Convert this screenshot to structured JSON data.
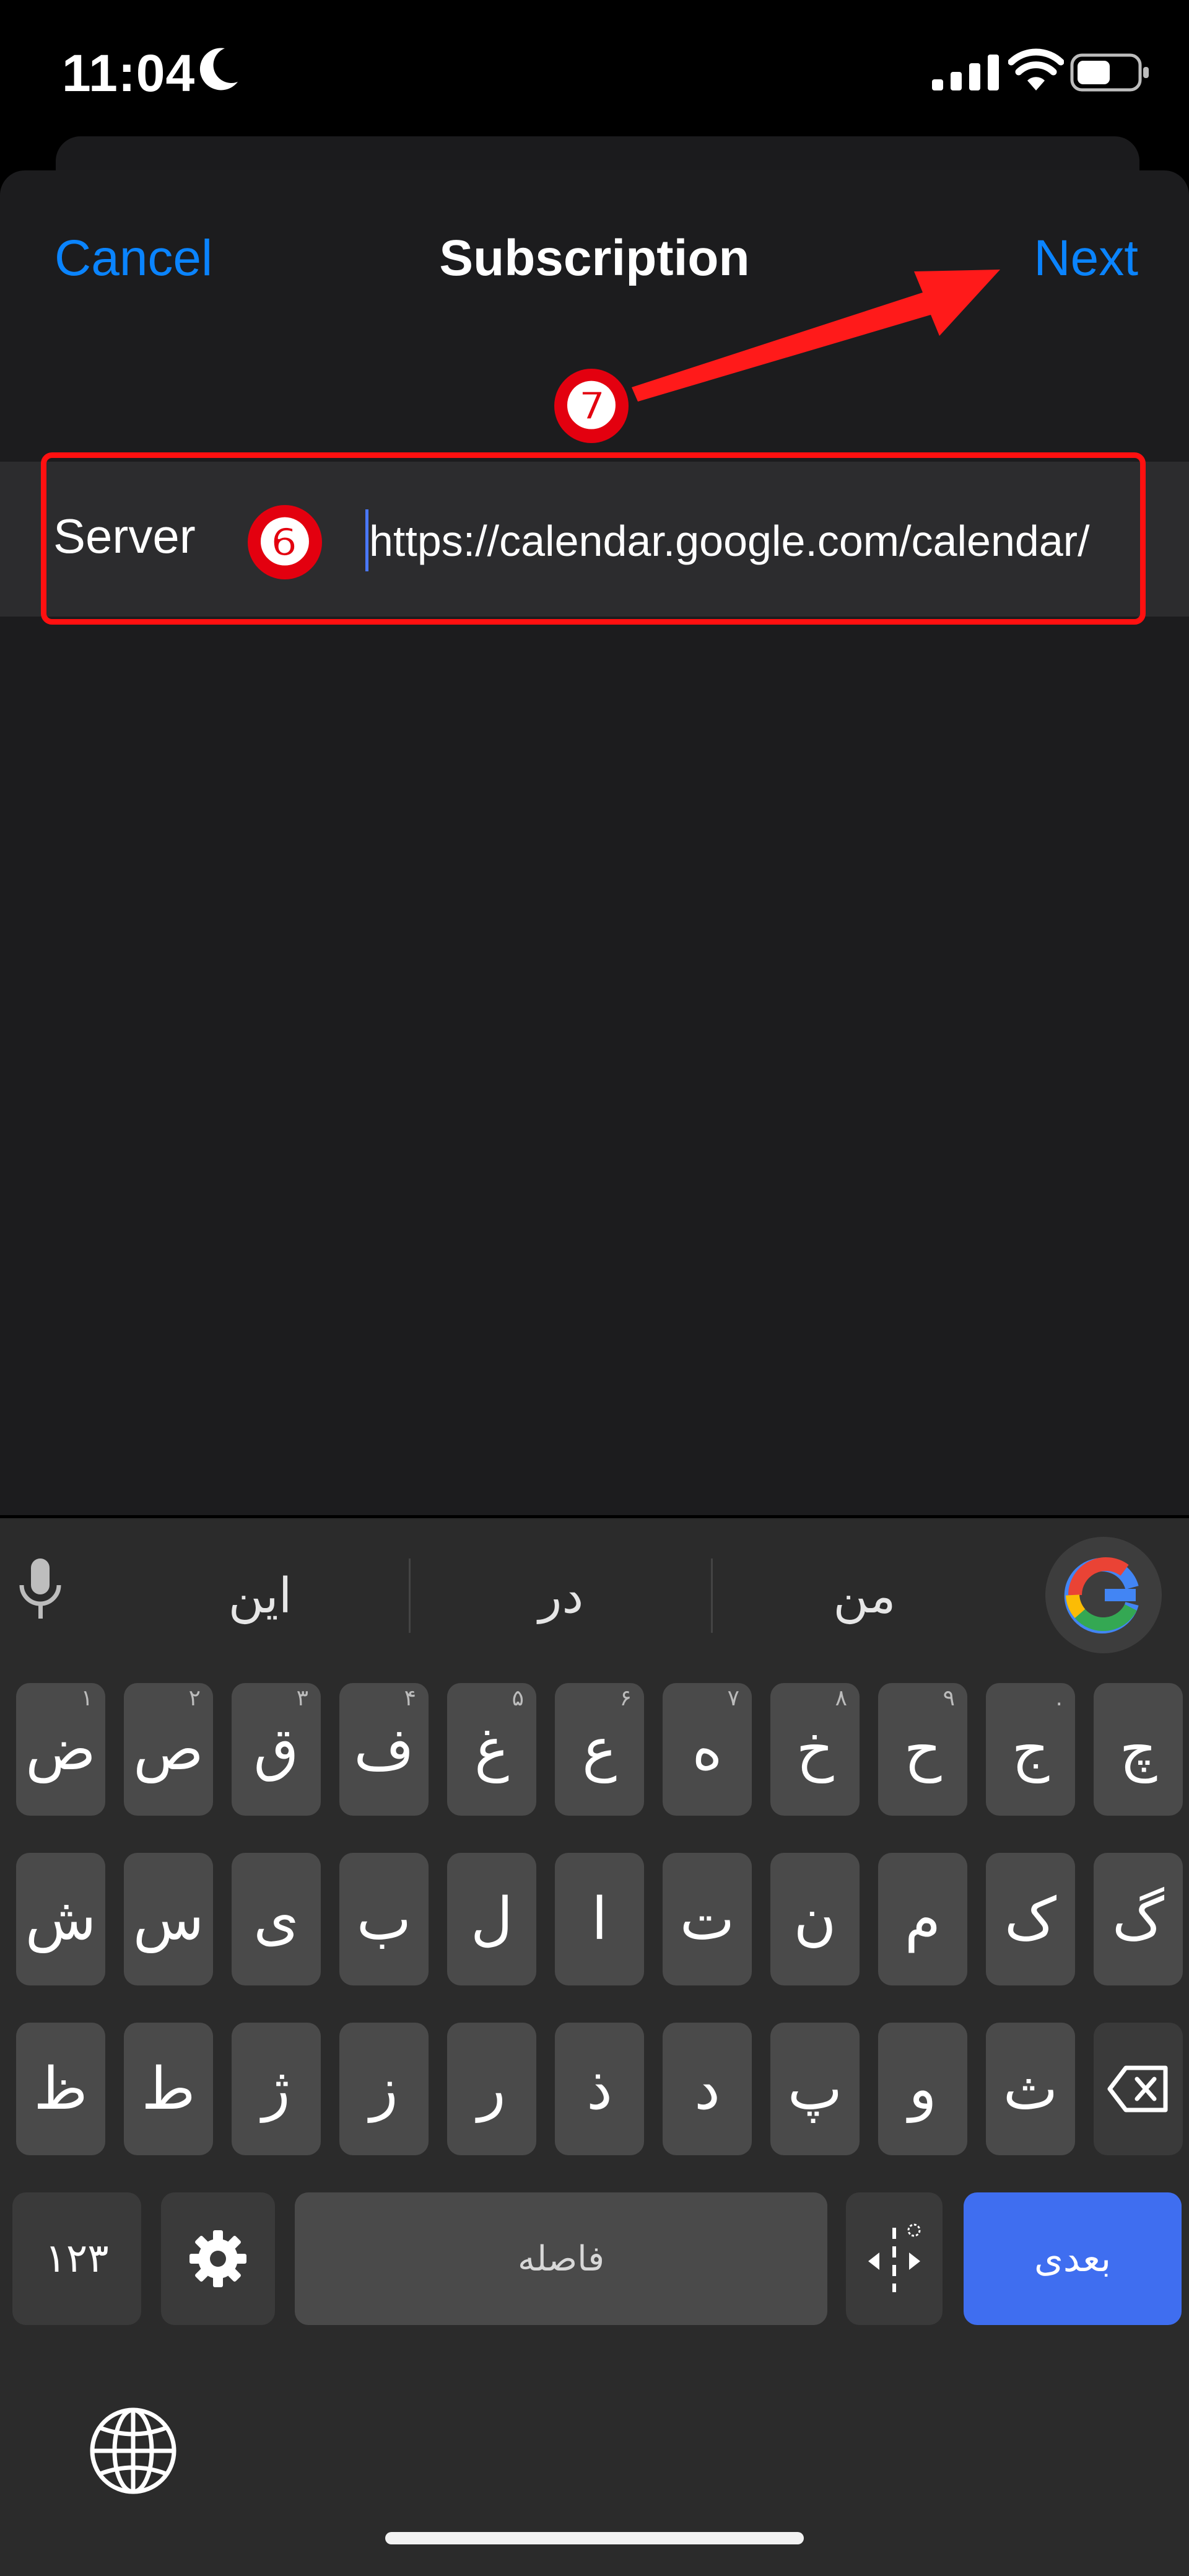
{
  "status_bar": {
    "time": "11:04"
  },
  "nav": {
    "cancel": "Cancel",
    "title": "Subscription",
    "next": "Next"
  },
  "form": {
    "server_label": "Server",
    "server_value": "https://calendar.google.com/calendar/"
  },
  "annotations": {
    "badge_server": "❻",
    "badge_next": "❼"
  },
  "keyboard": {
    "suggestions": [
      "من",
      "در",
      "این"
    ],
    "row1": [
      {
        "key": "چ",
        "hint": ""
      },
      {
        "key": "ج",
        "hint": "."
      },
      {
        "key": "ح",
        "hint": "۹"
      },
      {
        "key": "خ",
        "hint": "۸"
      },
      {
        "key": "ه",
        "hint": "۷"
      },
      {
        "key": "ع",
        "hint": "۶"
      },
      {
        "key": "غ",
        "hint": "۵"
      },
      {
        "key": "ف",
        "hint": "۴"
      },
      {
        "key": "ق",
        "hint": "۳"
      },
      {
        "key": "ص",
        "hint": "۲"
      },
      {
        "key": "ض",
        "hint": "۱"
      }
    ],
    "row2": [
      "گ",
      "ک",
      "م",
      "ن",
      "ت",
      "ا",
      "ل",
      "ب",
      "ی",
      "س",
      "ش"
    ],
    "row3": [
      "ث",
      "و",
      "پ",
      "د",
      "ذ",
      "ر",
      "ز",
      "ژ",
      "ط",
      "ظ"
    ],
    "numbers_label": "۱۲۳",
    "space_label": "فاصله",
    "enter_label": "بعدی"
  },
  "colors": {
    "accent": "#0a84ff",
    "annotation": "#ff1010",
    "enter_key": "#3f6ef0"
  },
  "icons": [
    "moon-icon",
    "signal-icon",
    "wifi-icon",
    "battery-icon",
    "mic-icon",
    "google-icon",
    "settings-icon",
    "cursor-move-icon",
    "backspace-icon",
    "globe-icon"
  ]
}
